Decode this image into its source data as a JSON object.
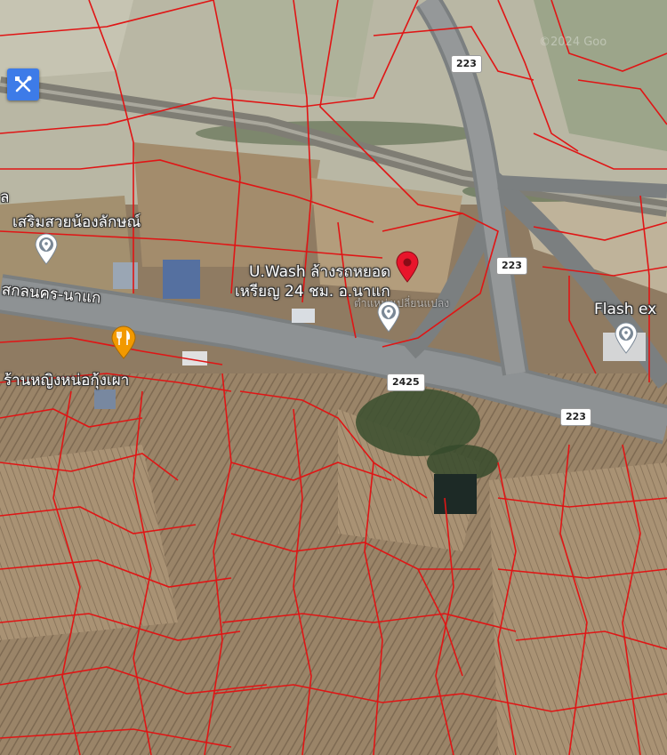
{
  "map": {
    "labels": {
      "road_main": "สกลนคร-นาแก",
      "business_1_line1": "U.Wash ล้างรถหยอด",
      "business_1_line2": "เหรียญ 24 ชม. อ.นาแก",
      "business_2": "เสริมสวยน้องลักษณ์",
      "business_3": "ร้านหญิงหน่อกุ้งเผา",
      "business_4": "Flash ex",
      "business_5": "ตำแหน่งเปลี่ยนแปลง",
      "edge_char": "ล",
      "watermark": "©2024 Goo"
    },
    "route_shields": {
      "r223_top": "223",
      "r223_mid": "223",
      "r223_right": "223",
      "r2425": "2425"
    },
    "colors": {
      "parcel_lines": "#e01515",
      "selected_pin": "#e8152b",
      "place_pin": "#ffffff",
      "food_pin": "#f29900",
      "tool_button": "#3d7be8"
    },
    "icons": {
      "tool_button": "crossed-tools-icon",
      "selected_pin": "red-location-pin-icon",
      "place_pin": "grey-location-pin-icon",
      "food_pin": "restaurant-pin-icon"
    }
  }
}
